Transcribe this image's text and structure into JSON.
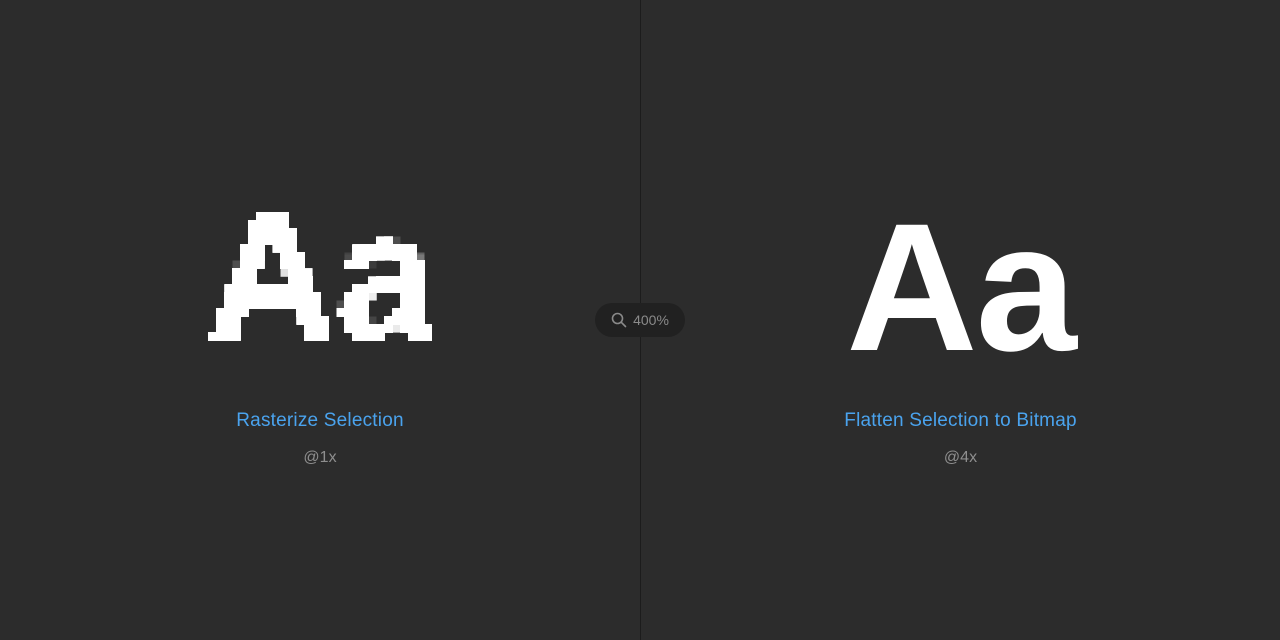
{
  "zoom": {
    "icon": "magnifier-icon",
    "level": "400%"
  },
  "left": {
    "sample_text": "Aa",
    "action": "Rasterize Selection",
    "scale": "@1x"
  },
  "right": {
    "sample_text": "Aa",
    "action": "Flatten Selection to Bitmap",
    "scale": "@4x"
  },
  "colors": {
    "background": "#2c2c2c",
    "accent": "#4aa3ee",
    "muted": "#8e8e8e",
    "glyph": "#ffffff"
  }
}
